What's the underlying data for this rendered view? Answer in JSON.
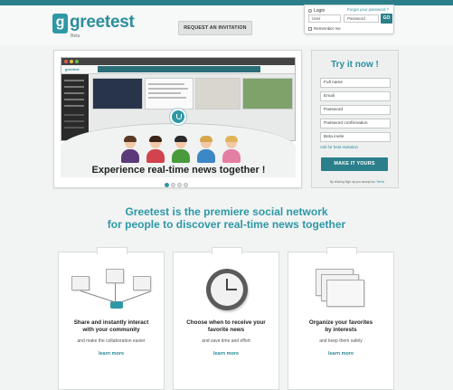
{
  "colors": {
    "brand": "#2c8e9c",
    "button": "#2b7f8a",
    "link": "#2a8a97"
  },
  "header": {
    "logo_name": "greetest",
    "logo_letter": "g",
    "logo_beta": "Beta",
    "request_button": "REQUEST AN INVITATION"
  },
  "login": {
    "label": "Login",
    "forgot": "Forgot your password ?",
    "user_placeholder": "User",
    "password_placeholder": "Password",
    "go": "GO",
    "remember": "Remember me"
  },
  "hero": {
    "title": "Experience real-time news together !",
    "screenshot_logo": "greetest",
    "pager": {
      "count": 4,
      "active": 1
    }
  },
  "signup": {
    "title": "Try it now !",
    "fields": [
      "Full name",
      "Email",
      "Password",
      "Password confirmation",
      "Beta invite"
    ],
    "beta_link": "Ask for beta invitation",
    "button": "MAKE IT YOURS",
    "terms_prefix": "By clicking Sign up you accept our",
    "terms_link": "Terms"
  },
  "tagline": {
    "line1": "Greetest is the premiere social network",
    "line2": "for people to discover real-time news together"
  },
  "features": [
    {
      "title1": "Share and instantly interact",
      "title2": "with your community",
      "sub": "and make the collaboration easier",
      "link": "learn more",
      "icon": "network-icon"
    },
    {
      "title1": "Choose when to receive your",
      "title2": "favorite news",
      "sub": "and save time and effort",
      "link": "learn more",
      "icon": "clock-icon"
    },
    {
      "title1": "Organize your favorites",
      "title2": "by interests",
      "sub": "and keep them safely",
      "link": "learn more",
      "icon": "stacked-pages-icon"
    }
  ]
}
